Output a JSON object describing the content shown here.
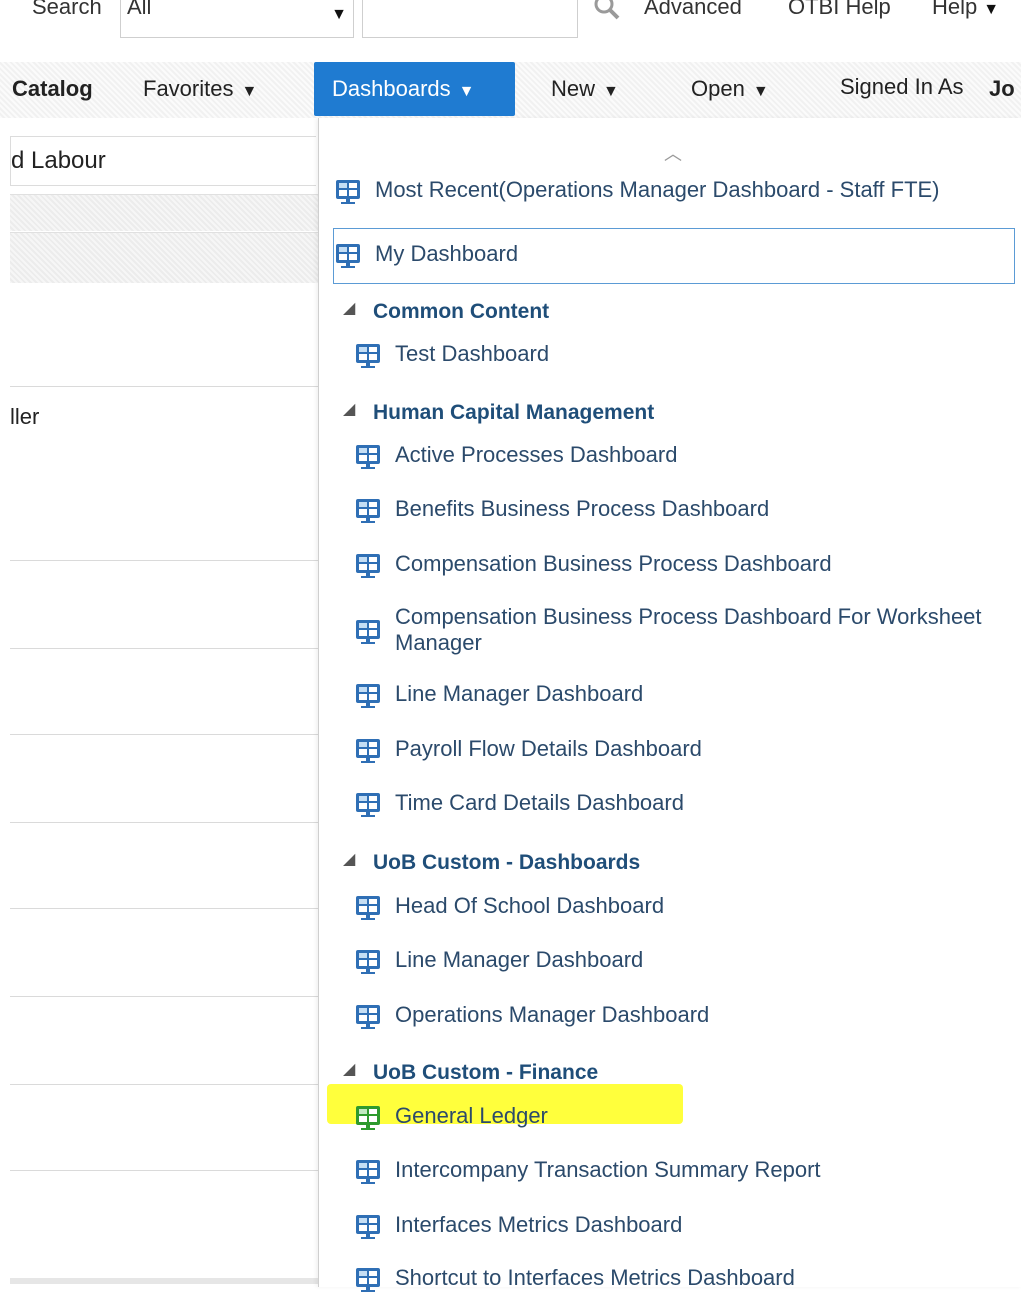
{
  "search": {
    "label": "Search",
    "scope_value": "All",
    "input_value": ""
  },
  "top_links": {
    "advanced": "Advanced",
    "otbi_help": "OTBI Help",
    "help": "Help"
  },
  "nav": {
    "catalog": "Catalog",
    "favorites": "Favorites",
    "dashboards": "Dashboards",
    "new": "New",
    "open": "Open",
    "signed_in_as": "Signed In As",
    "user": "Jo"
  },
  "left": {
    "crumb": "d Labour",
    "row_text": "ller"
  },
  "menu": {
    "most_recent": "Most Recent(Operations Manager Dashboard - Staff FTE)",
    "my_dashboard": "My Dashboard",
    "groups": [
      {
        "name": "Common Content",
        "items": [
          "Test Dashboard"
        ]
      },
      {
        "name": "Human Capital Management",
        "items": [
          "Active Processes Dashboard",
          "Benefits Business Process Dashboard",
          "Compensation Business Process Dashboard",
          "Compensation Business Process Dashboard For Worksheet Manager",
          "Line Manager Dashboard",
          "Payroll Flow Details Dashboard",
          "Time Card Details Dashboard"
        ]
      },
      {
        "name": "UoB Custom - Dashboards",
        "items": [
          "Head Of School Dashboard",
          "Line Manager Dashboard",
          "Operations Manager Dashboard"
        ]
      },
      {
        "name": "UoB Custom - Finance",
        "items": [
          "General Ledger",
          "Intercompany Transaction Summary Report",
          "Interfaces Metrics Dashboard",
          "Shortcut to Interfaces Metrics Dashboard"
        ]
      }
    ]
  },
  "icons": {
    "dashboard": "dashboard-icon",
    "search": "search-icon",
    "caret": "caret-down-icon",
    "expand": "expanded-triangle-icon"
  },
  "colors": {
    "active_tab": "#1f7bd1",
    "menu_text": "#2b4a6b",
    "group_text": "#1f4e79",
    "highlight": "#ffff3c",
    "highlight_icon": "#2e9a2e"
  }
}
